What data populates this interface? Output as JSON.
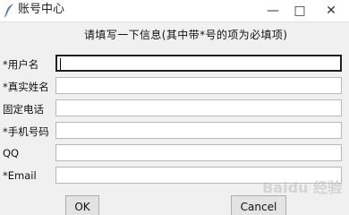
{
  "window": {
    "title": "账号中心",
    "icon": "feather-icon",
    "controls": [
      "minimize-icon",
      "maximize-icon",
      "close-icon"
    ]
  },
  "notice": "请填写一下信息(其中带*号的项为必填项)",
  "form": {
    "fields": [
      {
        "label": "*用户名",
        "value": ""
      },
      {
        "label": "*真实姓名",
        "value": ""
      },
      {
        "label": "固定电话",
        "value": ""
      },
      {
        "label": "*手机号码",
        "value": ""
      },
      {
        "label": "QQ",
        "value": ""
      },
      {
        "label": "*Email",
        "value": ""
      }
    ]
  },
  "buttons": {
    "ok": "OK",
    "cancel": "Cancel"
  },
  "watermark": "Baidu 经验",
  "colors": {
    "background": "#f0f0f0",
    "titlebar": "#ffffff",
    "field_border": "#b8b8b8",
    "active_border": "#1e1e1e"
  }
}
